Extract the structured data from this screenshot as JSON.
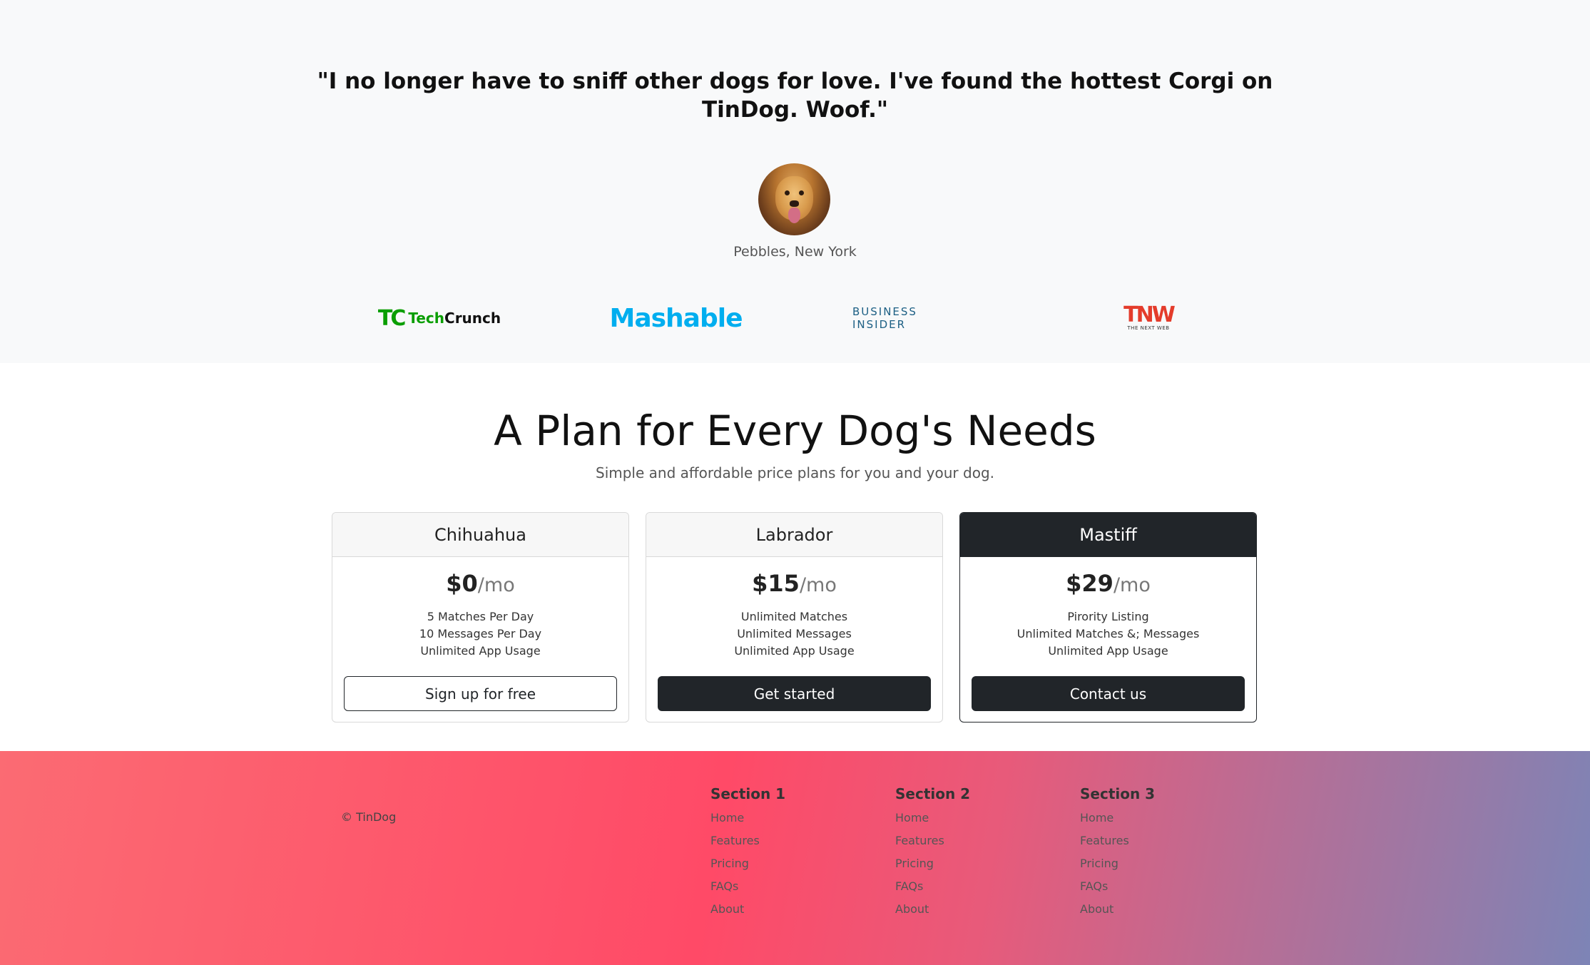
{
  "testimonial": {
    "quote": "\"I no longer have to sniff other dogs for love. I've found the hottest Corgi on TinDog. Woof.\"",
    "caption": "Pebbles, New York"
  },
  "press": {
    "techcrunch_mark": "TC",
    "techcrunch_tech": "Tech",
    "techcrunch_crunch": "Crunch",
    "mashable": "Mashable",
    "business_insider": "BUSINESS INSIDER",
    "tnw_big": "TNW",
    "tnw_small": "THE NEXT WEB"
  },
  "pricing": {
    "title": "A Plan for Every Dog's Needs",
    "subtitle": "Simple and affordable price plans for you and your dog.",
    "per": "/mo",
    "plans": [
      {
        "name": "Chihuahua",
        "price": "$0",
        "features": [
          "5 Matches Per Day",
          "10 Messages Per Day",
          "Unlimited App Usage"
        ],
        "button": "Sign up for free"
      },
      {
        "name": "Labrador",
        "price": "$15",
        "features": [
          "Unlimited Matches",
          "Unlimited Messages",
          "Unlimited App Usage"
        ],
        "button": "Get started"
      },
      {
        "name": "Mastiff",
        "price": "$29",
        "features": [
          "Pirority Listing",
          "Unlimited Matches &; Messages",
          "Unlimited App Usage"
        ],
        "button": "Contact us"
      }
    ]
  },
  "footer": {
    "copyright": "© TinDog",
    "sections": [
      {
        "title": "Section 1",
        "links": [
          "Home",
          "Features",
          "Pricing",
          "FAQs",
          "About"
        ]
      },
      {
        "title": "Section 2",
        "links": [
          "Home",
          "Features",
          "Pricing",
          "FAQs",
          "About"
        ]
      },
      {
        "title": "Section 3",
        "links": [
          "Home",
          "Features",
          "Pricing",
          "FAQs",
          "About"
        ]
      }
    ]
  },
  "colors": {
    "dark": "#212529",
    "testimonial_bg": "#f8f9fa",
    "footer_gradient_start": "#fb6b73",
    "footer_gradient_mid": "#ff4a67",
    "footer_gradient_end": "#7d84b6"
  }
}
